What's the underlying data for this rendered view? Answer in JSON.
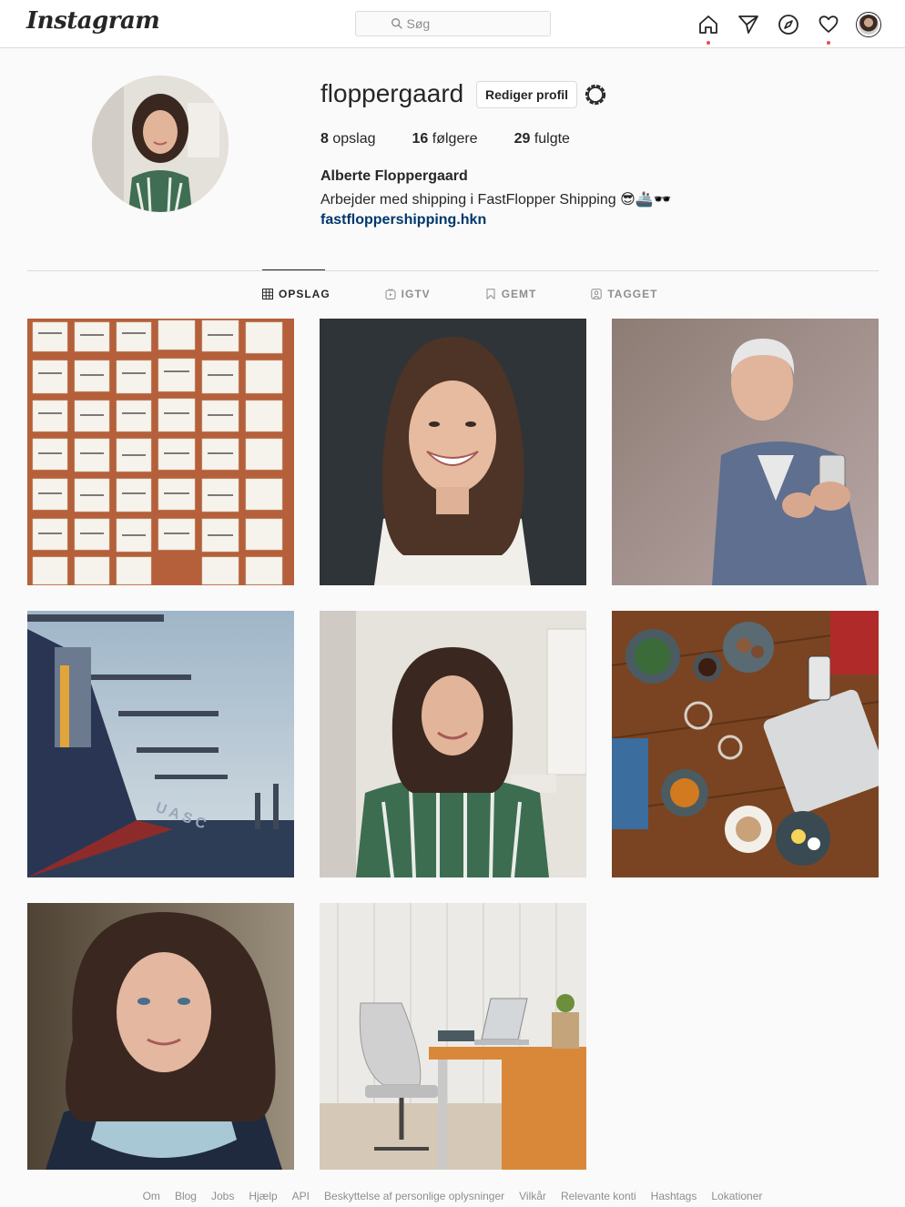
{
  "topbar": {
    "logo": "Instagram",
    "search_placeholder": "Søg",
    "icons": [
      "home-icon",
      "direct-icon",
      "explore-icon",
      "activity-heart-icon",
      "profile-avatar"
    ]
  },
  "profile": {
    "username": "floppergaard",
    "edit_button": "Rediger profil",
    "posts_count": "8",
    "posts_label": "opslag",
    "followers_count": "16",
    "followers_label": "følgere",
    "following_count": "29",
    "following_label": "fulgte",
    "full_name": "Alberte Floppergaard",
    "bio": "Arbejder med shipping i FastFlopper Shipping 😎🚢🕶️",
    "website": "fastfloppershipping.hkn"
  },
  "tabs": [
    {
      "label": "OPSLAG",
      "icon": "grid-icon",
      "active": true
    },
    {
      "label": "IGTV",
      "icon": "igtv-icon",
      "active": false
    },
    {
      "label": "GEMT",
      "icon": "bookmark-icon",
      "active": false
    },
    {
      "label": "TAGGET",
      "icon": "tagged-icon",
      "active": false
    }
  ],
  "posts": [
    {
      "subject": "sticky notes wall"
    },
    {
      "subject": "smiling woman portrait"
    },
    {
      "subject": "man with phone"
    },
    {
      "subject": "container ship"
    },
    {
      "subject": "woman in green dress"
    },
    {
      "subject": "coffee table flatlay"
    },
    {
      "subject": "woman with scarf"
    },
    {
      "subject": "office desk with laptop"
    }
  ],
  "footer": [
    "Om",
    "Blog",
    "Jobs",
    "Hjælp",
    "API",
    "Beskyttelse af personlige oplysninger",
    "Vilkår",
    "Relevante konti",
    "Hashtags",
    "Lokationer"
  ],
  "colors": {
    "link": "#00376b",
    "notification_dot": "#ed4956",
    "border": "#dbdbdb"
  }
}
